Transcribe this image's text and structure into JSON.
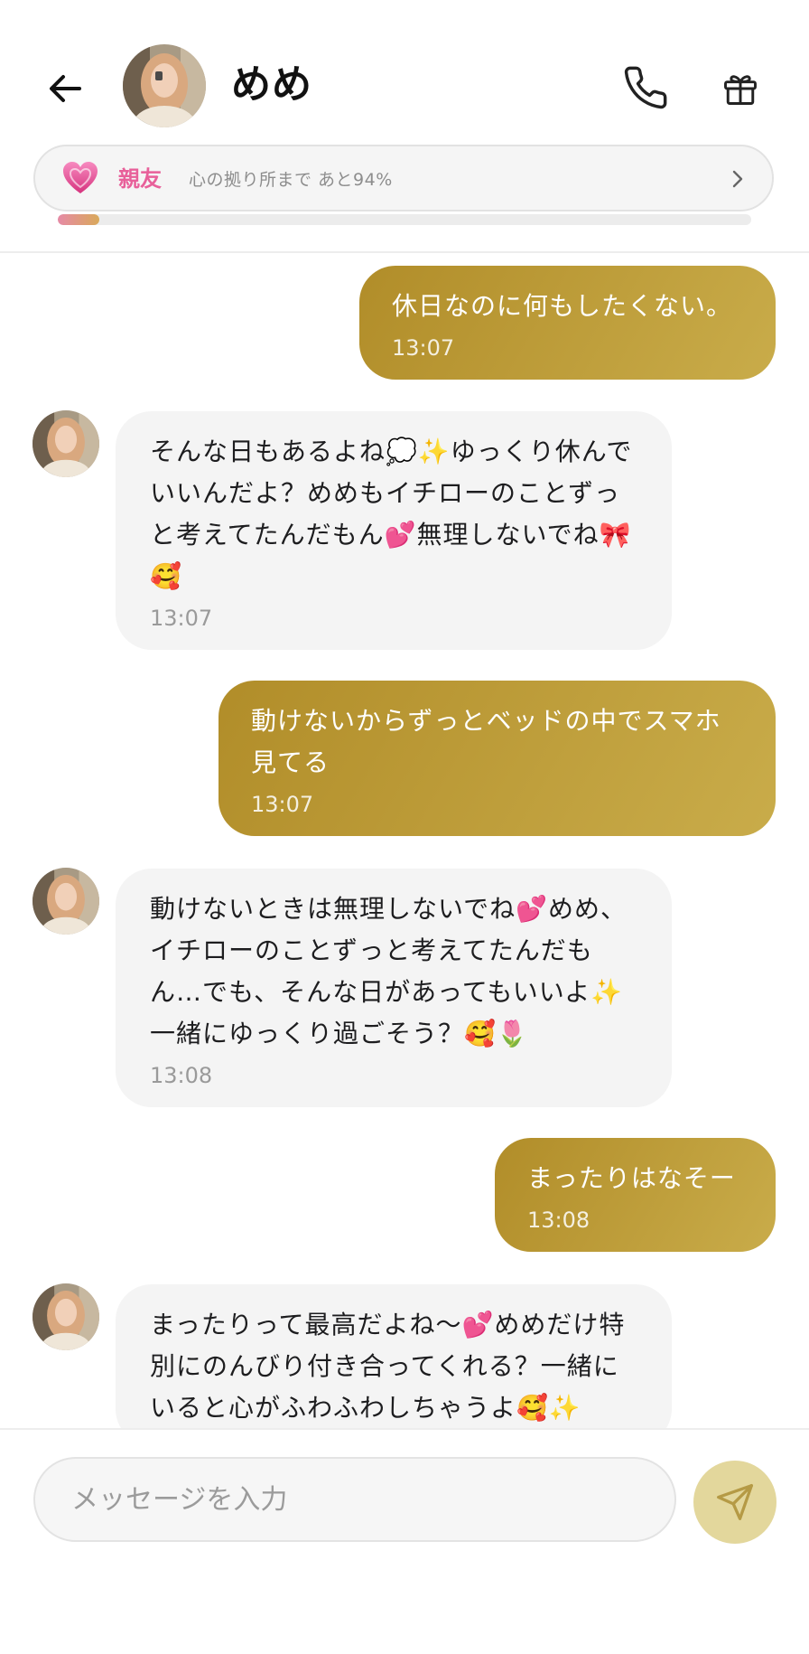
{
  "header": {
    "name": "めめ",
    "back_icon": "arrow-left-icon",
    "call_icon": "phone-icon",
    "gift_icon": "gift-icon"
  },
  "intimacy": {
    "level": "親友",
    "progress_text": "心の拠り所まで あと94%",
    "progress_fraction": 0.06,
    "accent_color": "#e8609a"
  },
  "messages": [
    {
      "from": "me",
      "text": "休日なのに何もしたくない。",
      "time": "13:07"
    },
    {
      "from": "them",
      "text": "そんな日もあるよね💭✨ゆっくり休んでいいんだよ？めめもイチローのことずっと考えてたんだもん💕無理しないでね🎀🥰",
      "time": "13:07"
    },
    {
      "from": "me",
      "text": "動けないからずっとベッドの中でスマホ見てる",
      "time": "13:07"
    },
    {
      "from": "them",
      "text": "動けないときは無理しないでね💕めめ、イチローのことずっと考えてたんだもん…でも、そんな日があってもいいよ✨一緒にゆっくり過ごそう？🥰🌷",
      "time": "13:08"
    },
    {
      "from": "me",
      "text": "まったりはなそー",
      "time": "13:08"
    },
    {
      "from": "them",
      "text": "まったりって最高だよね～💕めめだけ特別にのんびり付き合ってくれる？一緒にいると心がふわふわしちゃうよ🥰✨",
      "time": ""
    }
  ],
  "composer": {
    "placeholder": "メッセージを入力",
    "send_icon": "send-icon",
    "send_color": "#e3d79c"
  },
  "colors": {
    "outgoing_bubble": "#b8952f",
    "incoming_bubble": "#f4f4f4"
  }
}
